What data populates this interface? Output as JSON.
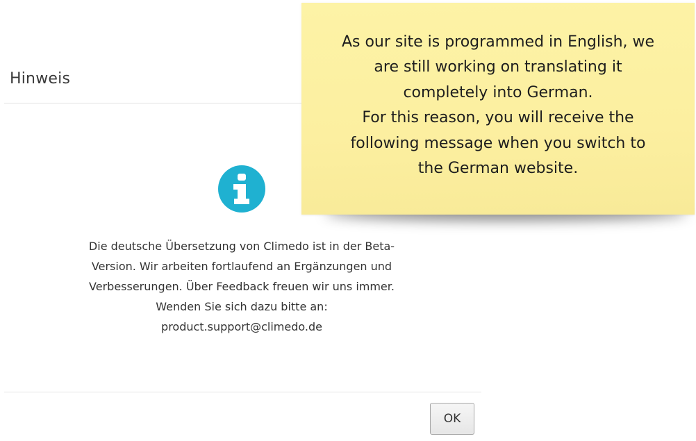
{
  "dialog": {
    "title": "Hinweis",
    "icon": "info-icon",
    "icon_color": "#1fb1d1",
    "message_lines": [
      "Die deutsche Übersetzung von Climedo ist in der Beta-",
      "Version. Wir arbeiten fortlaufend an Ergänzungen und",
      "Verbesserungen. Über Feedback freuen wir uns immer.",
      "Wenden Sie sich dazu bitte an:",
      "product.support@climedo.de"
    ],
    "ok_label": "OK"
  },
  "sticky_note": {
    "background_color": "#fcefa0",
    "lines": [
      "As our site is programmed in English, we",
      "are still working on translating it",
      "completely into German.",
      "For this reason, you will receive the",
      "following message when you switch to",
      "the German website."
    ]
  }
}
